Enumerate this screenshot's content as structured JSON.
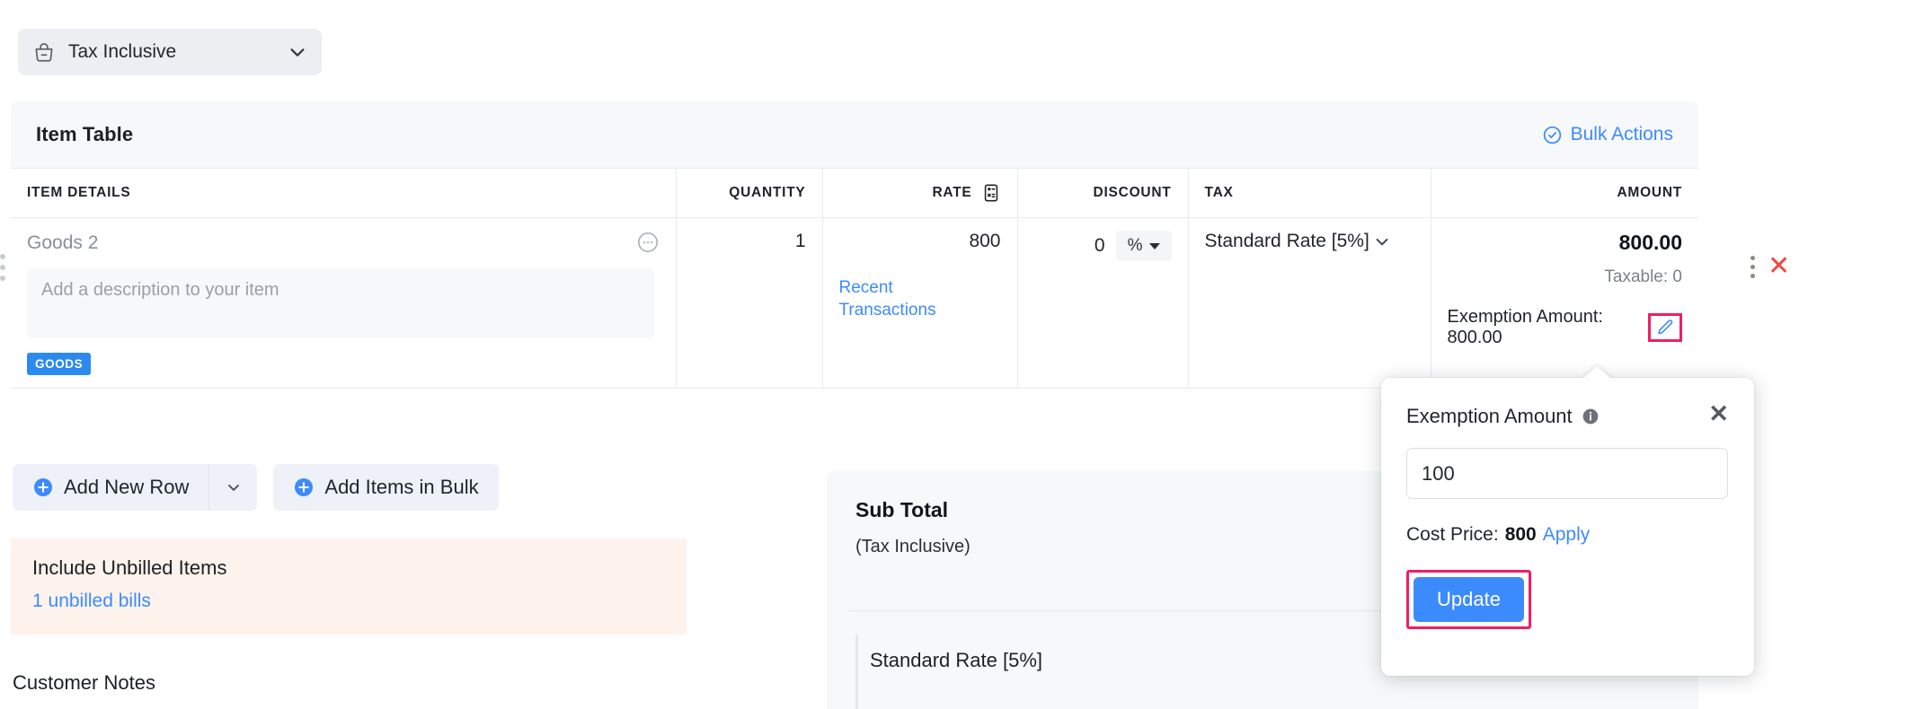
{
  "tax_mode_select": {
    "label": "Tax Inclusive",
    "icon": "bag-minus-icon",
    "chevron": "chevron-down-icon"
  },
  "item_table": {
    "title": "Item Table",
    "bulk_actions": {
      "label": "Bulk Actions",
      "icon": "check-circle-icon"
    },
    "columns": {
      "item_details": "ITEM DETAILS",
      "quantity": "QUANTITY",
      "rate": "RATE",
      "rate_icon": "calculator-icon",
      "discount": "DISCOUNT",
      "tax": "TAX",
      "amount": "AMOUNT"
    },
    "rows": [
      {
        "name": "Goods 2",
        "description_placeholder": "Add a description to your item",
        "tag": "GOODS",
        "quantity": "1",
        "rate": "800",
        "rate_link": "Recent Transactions",
        "discount_value": "0",
        "discount_unit": "%",
        "tax": "Standard Rate [5%]",
        "amount": "800.00",
        "taxable": "Taxable: 0",
        "exemption_amount": "Exemption Amount: 800.00",
        "edit_icon": "pencil-icon",
        "more_icon": "vertical-dots-icon",
        "delete_icon": "close-x-icon",
        "row_menu_icon": "ellipsis-circle-icon",
        "drag_icon": "drag-handle-icon"
      }
    ]
  },
  "actions": {
    "add_new_row": "Add New Row",
    "add_new_row_icon": "plus-circle-icon",
    "add_new_row_chevron": "chevron-down-icon",
    "add_items_bulk": "Add Items in Bulk",
    "add_items_bulk_icon": "plus-circle-icon"
  },
  "unbilled_banner": {
    "title": "Include Unbilled Items",
    "link": "1 unbilled bills"
  },
  "customer_notes_label": "Customer Notes",
  "summary": {
    "sub_total_label": "Sub Total",
    "sub_total_note": "(Tax Inclusive)",
    "tax_row_label": "Standard Rate [5%]"
  },
  "exemption_popup": {
    "title": "Exemption Amount",
    "info_icon": "info-icon",
    "close_icon": "close-icon",
    "input_value": "100",
    "cost_price_label": "Cost Price:",
    "cost_price_value": "800",
    "apply_label": "Apply",
    "update_label": "Update"
  },
  "colors": {
    "accent_blue": "#3c8bfc",
    "highlight_pink": "#ef1f62",
    "delete_red": "#f4453f",
    "banner_bg": "#fdf3ec",
    "panel_bg": "#f7f8fa",
    "tag_blue": "#2c8aef"
  }
}
